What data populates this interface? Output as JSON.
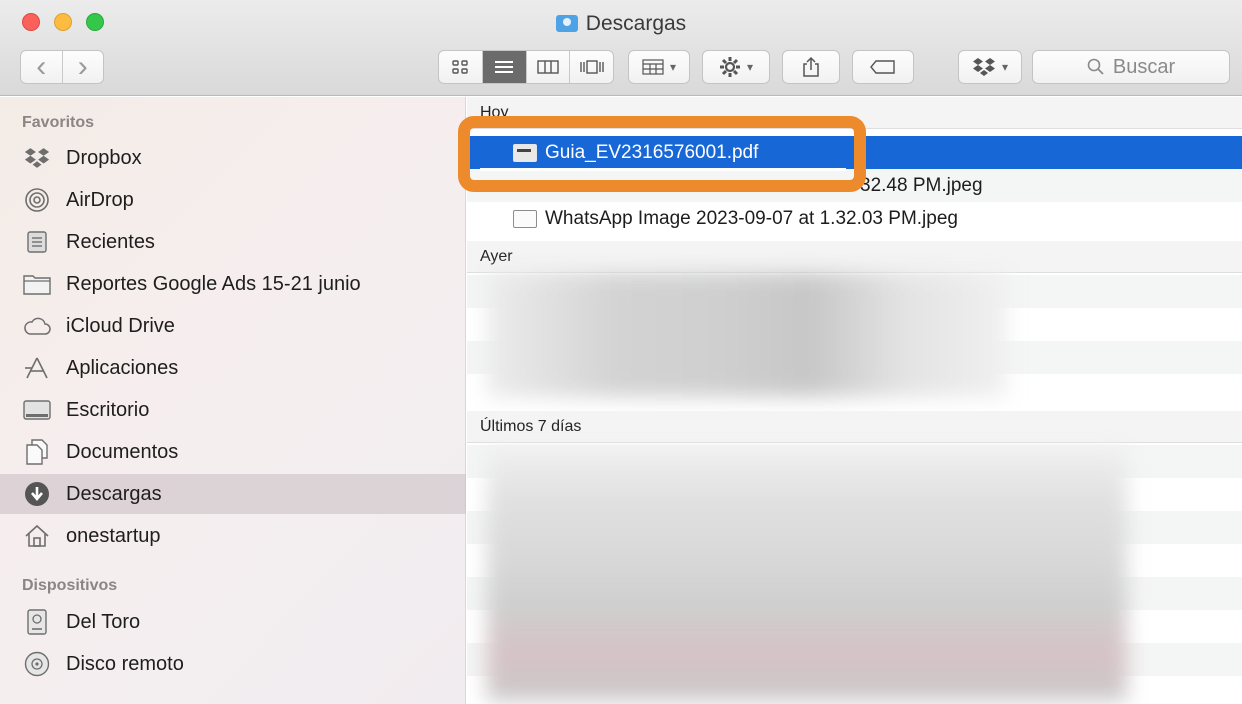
{
  "window": {
    "title": "Descargas"
  },
  "toolbar": {
    "back_glyph": "‹",
    "forward_glyph": "›",
    "views": [
      "icon-view-icon",
      "list-view-icon",
      "column-view-icon",
      "coverflow-view-icon"
    ],
    "search_label": "Buscar"
  },
  "sidebar": {
    "favorites_label": "Favoritos",
    "favorites": [
      {
        "label": "Dropbox",
        "icon": "dropbox-icon"
      },
      {
        "label": "AirDrop",
        "icon": "airdrop-icon"
      },
      {
        "label": "Recientes",
        "icon": "recents-icon"
      },
      {
        "label": "Reportes Google Ads 15-21 junio",
        "icon": "folder-icon"
      },
      {
        "label": "iCloud Drive",
        "icon": "cloud-icon"
      },
      {
        "label": "Aplicaciones",
        "icon": "applications-icon"
      },
      {
        "label": "Escritorio",
        "icon": "desktop-icon"
      },
      {
        "label": "Documentos",
        "icon": "documents-icon"
      },
      {
        "label": "Descargas",
        "icon": "downloads-icon"
      },
      {
        "label": "onestartup",
        "icon": "home-icon"
      }
    ],
    "devices_label": "Dispositivos",
    "devices": [
      {
        "label": "Del Toro",
        "icon": "disk-icon"
      },
      {
        "label": "Disco remoto",
        "icon": "remote-disc-icon"
      }
    ]
  },
  "main": {
    "sections": [
      {
        "label": "Hoy",
        "files": [
          {
            "name": "Guia_EV2316576001.pdf",
            "selected": true
          },
          {
            "name": "32.48 PM.jpeg",
            "selected": false
          },
          {
            "name": "WhatsApp Image 2023-09-07 at 1.32.03 PM.jpeg",
            "selected": false
          }
        ]
      },
      {
        "label": "Ayer",
        "files": []
      },
      {
        "label": "Últimos 7 días",
        "files": []
      }
    ]
  },
  "colors": {
    "selection": "#1768d6",
    "annotation": "#ec8a2c"
  }
}
